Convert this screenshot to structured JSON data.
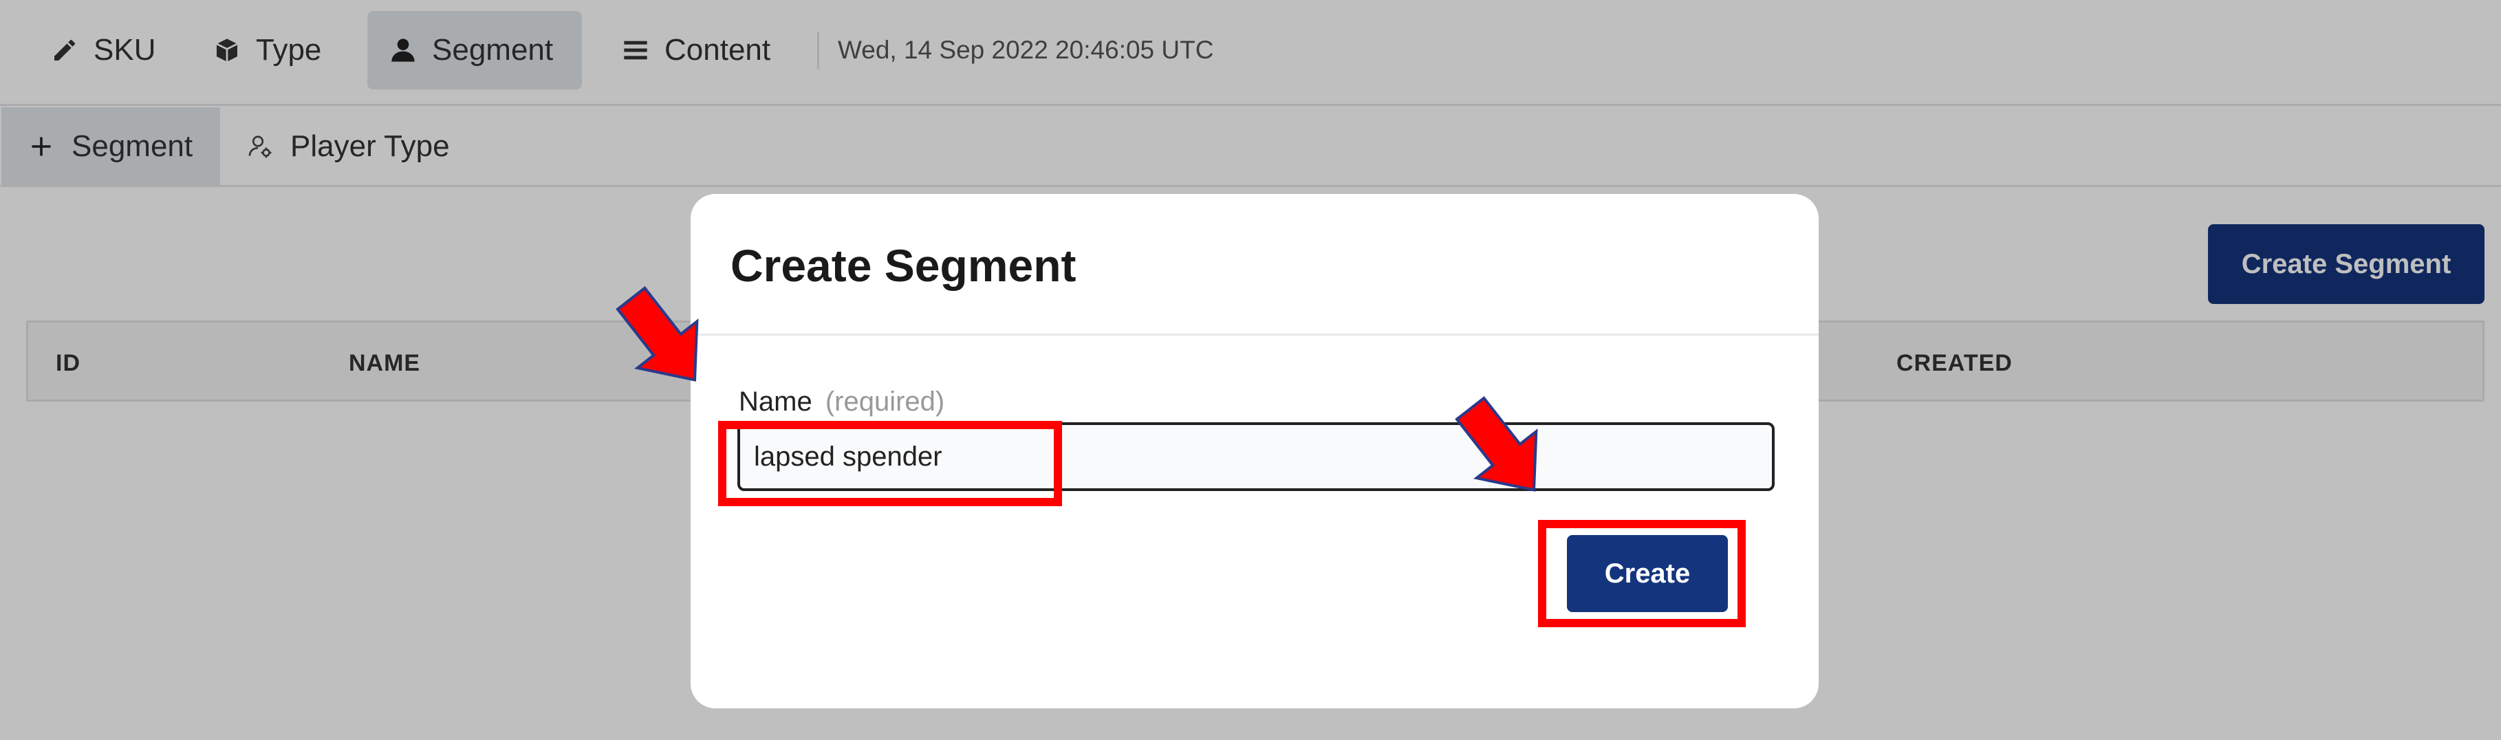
{
  "topnav": {
    "items": [
      {
        "label": "SKU",
        "icon": "pencil-icon"
      },
      {
        "label": "Type",
        "icon": "cube-icon"
      },
      {
        "label": "Segment",
        "icon": "user-icon",
        "active": true
      },
      {
        "label": "Content",
        "icon": "list-icon"
      }
    ],
    "timestamp": "Wed, 14 Sep 2022 20:46:05 UTC"
  },
  "subnav": {
    "items": [
      {
        "label": "Segment",
        "icon": "plus-icon",
        "active": true
      },
      {
        "label": "Player Type",
        "icon": "user-gear-icon"
      }
    ]
  },
  "page": {
    "create_button_label": "Create Segment",
    "table": {
      "columns": [
        "ID",
        "NAME",
        "CREATED"
      ]
    }
  },
  "modal": {
    "title": "Create Segment",
    "field_label": "Name",
    "field_hint": "(required)",
    "name_value": "lapsed spender",
    "submit_label": "Create"
  },
  "colors": {
    "primary": "#14357d",
    "annotation": "#ff0000",
    "active_tab": "#e2e6ea"
  }
}
